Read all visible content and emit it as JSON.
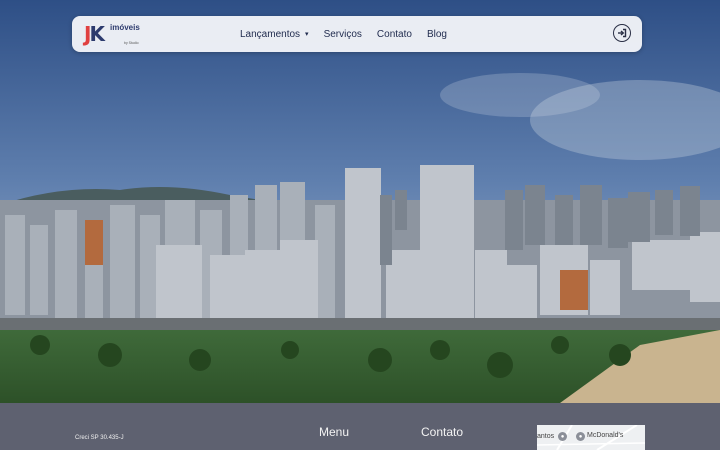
{
  "header": {
    "logo": {
      "brand": "JK",
      "word": "imóveis",
      "tagline": "by Studio"
    },
    "nav": [
      {
        "label": "Lançamentos",
        "has_dropdown": true
      },
      {
        "label": "Serviços"
      },
      {
        "label": "Contato"
      },
      {
        "label": "Blog"
      }
    ],
    "login_icon": "sign-in-icon"
  },
  "hero": {
    "image": "aerial-city-skyline-photo"
  },
  "footer": {
    "creci": "Creci SP 30.435-J",
    "menu_title": "Menu",
    "contato_title": "Contato",
    "map": {
      "place1": "antos",
      "place2": "McDonald's"
    }
  },
  "colors": {
    "nav_text": "#1f2a4d",
    "footer_bg": "#5e6170",
    "logo_red": "#e04040",
    "logo_blue": "#2d3b6e"
  }
}
